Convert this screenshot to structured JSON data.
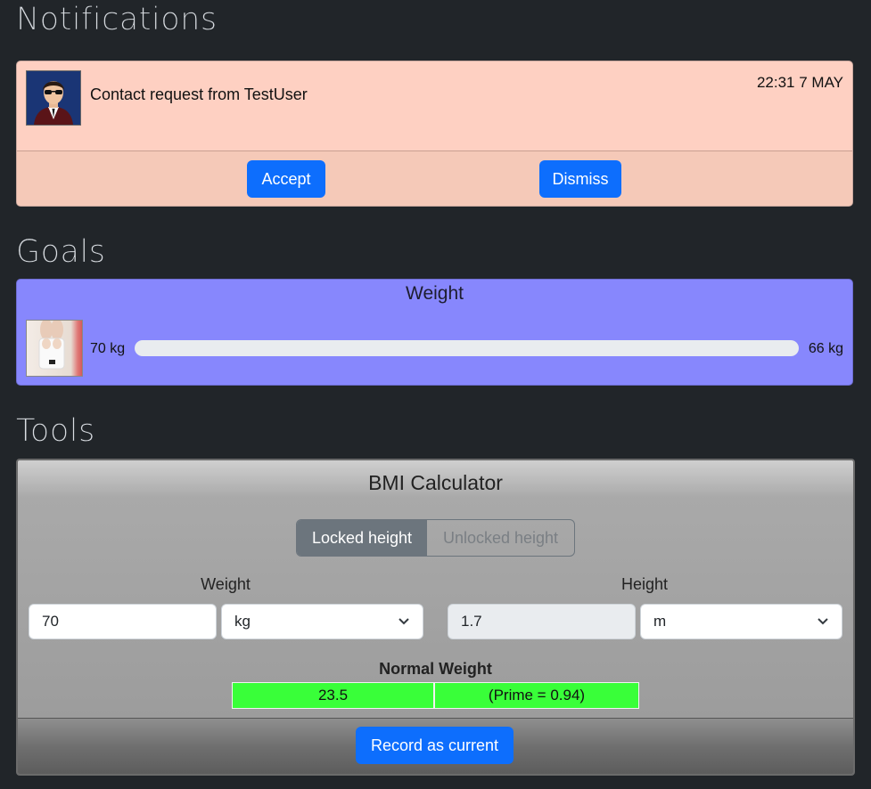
{
  "sections": {
    "notifications": "Notifications",
    "goals": "Goals",
    "tools": "Tools"
  },
  "notification": {
    "message": "Contact request from TestUser",
    "time": "22:31 7 MAY",
    "accept_label": "Accept",
    "dismiss_label": "Dismiss"
  },
  "goal": {
    "title": "Weight",
    "start_label": "70 kg",
    "target_label": "66 kg",
    "progress": 0
  },
  "bmi": {
    "title": "BMI Calculator",
    "toggle": {
      "locked": "Locked height",
      "unlocked": "Unlocked height"
    },
    "weight": {
      "label": "Weight",
      "value": "70",
      "unit": "kg"
    },
    "height": {
      "label": "Height",
      "value": "1.7",
      "unit": "m"
    },
    "result": {
      "category": "Normal Weight",
      "bmi": "23.5",
      "prime": "(Prime = 0.94)"
    },
    "record_label": "Record as current"
  },
  "colors": {
    "background": "#212529",
    "notification_bg": "#fed0c2",
    "goal_bg": "#8787fd",
    "primary": "#0d6efd",
    "result_bg": "#39ff39"
  }
}
